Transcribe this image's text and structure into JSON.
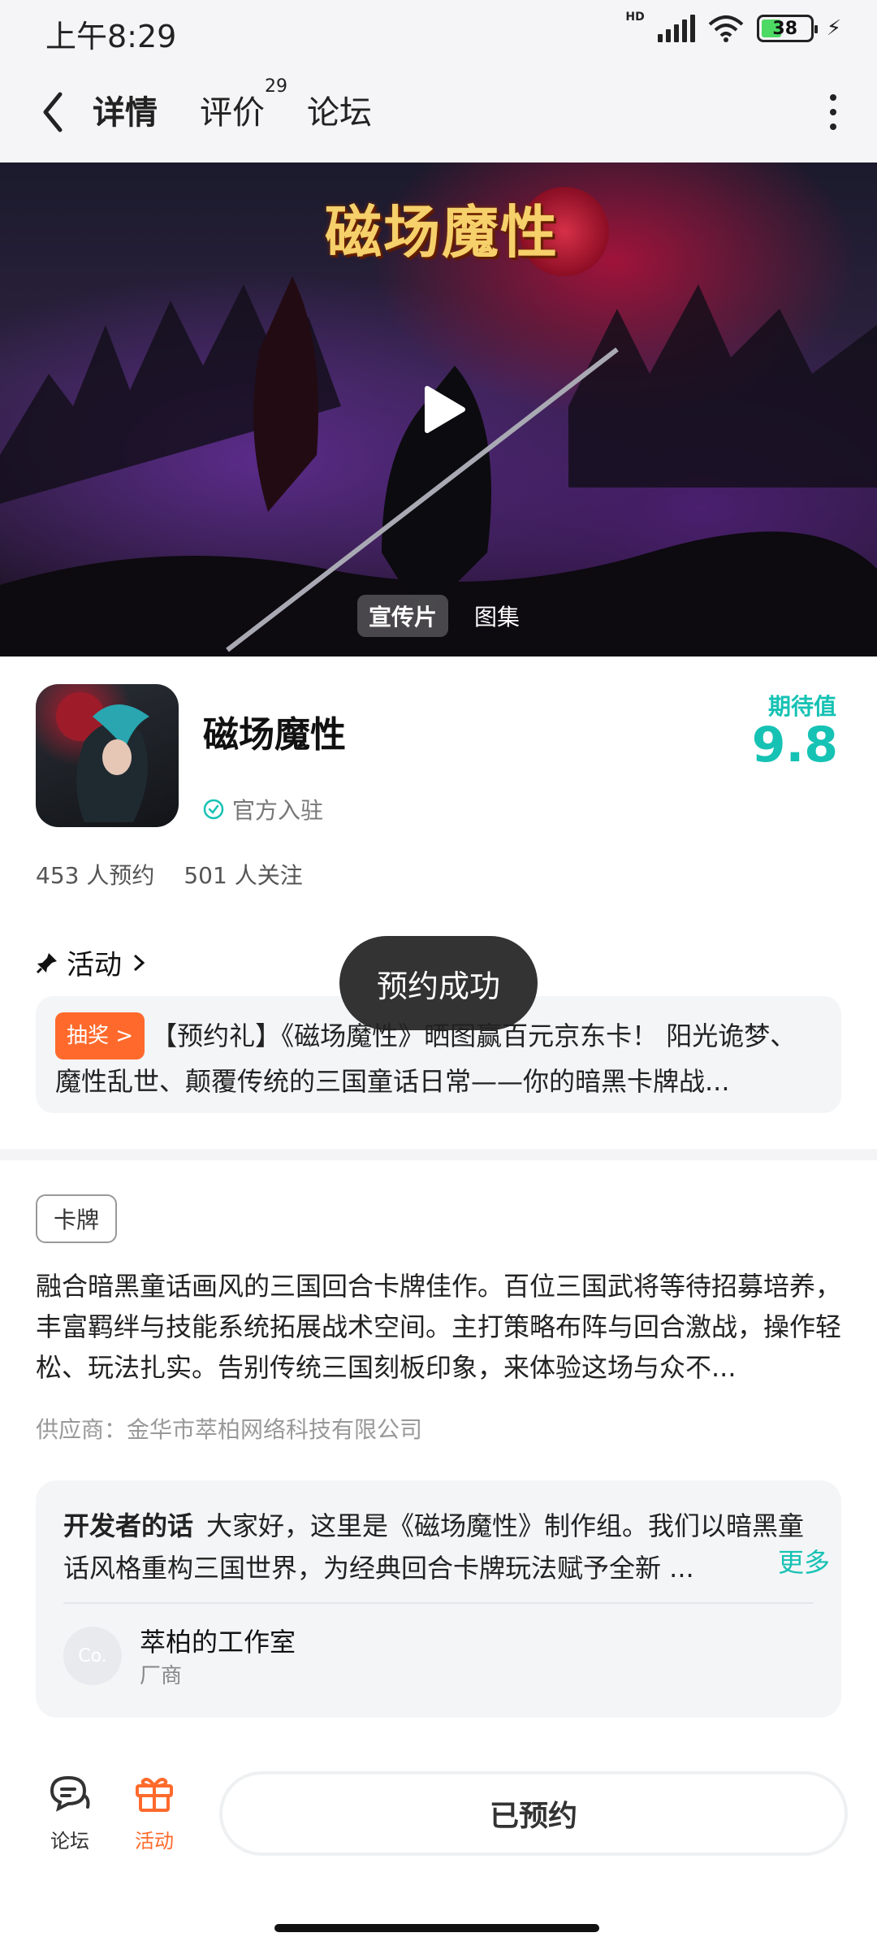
{
  "status_bar": {
    "time": "上午8:29",
    "network": "HD",
    "battery": "38"
  },
  "header": {
    "tabs": [
      {
        "label": "详情",
        "active": true
      },
      {
        "label": "评价",
        "count": "29"
      },
      {
        "label": "论坛"
      }
    ]
  },
  "banner": {
    "title": "磁场魔性",
    "media_tabs": [
      "宣传片",
      "图集"
    ]
  },
  "app": {
    "name": "磁场魔性",
    "official": "官方入驻",
    "rating_label": "期待值",
    "rating": "9.8",
    "reservations": "453 人预约",
    "followers": "501 人关注"
  },
  "activity": {
    "title": "活动",
    "tag": "抽奖 >",
    "text": "【预约礼】《磁场魔性》晒图赢百元京东卡！ 阳光诡梦、魔性乱世、颠覆传统的三国童话日常——你的暗黑卡牌战..."
  },
  "toast": "预约成功",
  "description": {
    "tag": "卡牌",
    "text": "融合暗黑童话画风的三国回合卡牌佳作。百位三国武将等待招募培养，丰富羁绊与技能系统拓展战术空间。主打策略布阵与回合激战，操作轻松、玩法扎实。告别传统三国刻板印象，来体验这场与众不...",
    "supplier": "供应商：金华市萃柏网络科技有限公司"
  },
  "developer": {
    "label": "开发者的话",
    "text": "大家好，这里是《磁场魔性》制作组。我们以暗黑童话风格重构三国世界，为经典回合卡牌玩法赋予全新 ...",
    "more": "更多",
    "avatar_text": "Co.",
    "name": "萃柏的工作室",
    "role": "厂商"
  },
  "bottom": {
    "forum": "论坛",
    "activity": "活动",
    "reserved": "已预约"
  },
  "colors": {
    "accent": "#16c2b4",
    "orange": "#ff6a2c"
  }
}
